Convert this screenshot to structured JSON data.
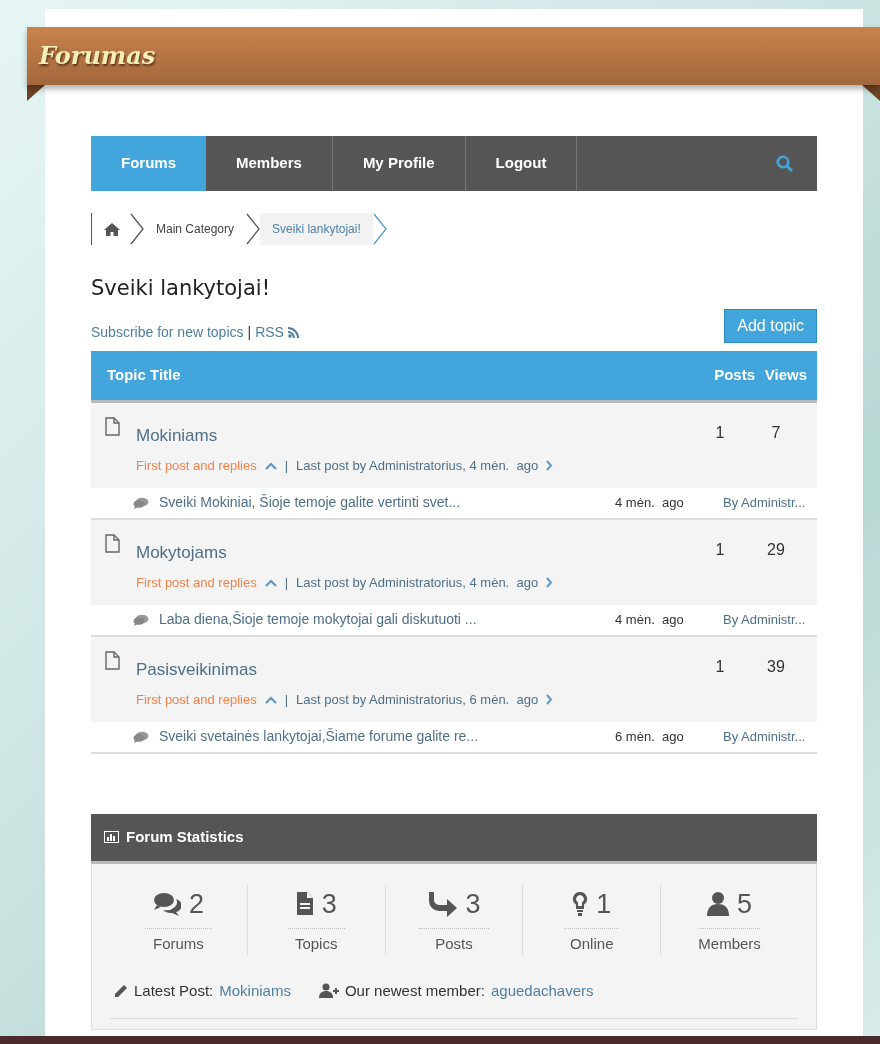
{
  "site_title": "Forumas",
  "nav": [
    {
      "label": "Forums",
      "selected": true
    },
    {
      "label": "Members",
      "selected": false
    },
    {
      "label": "My Profile",
      "selected": false
    },
    {
      "label": "Logout",
      "selected": false
    }
  ],
  "breadcrumb": [
    {
      "label": "Main Category",
      "selected": false
    },
    {
      "label": "Sveiki lankytojai!",
      "selected": true
    }
  ],
  "forum_title": "Sveiki lankytojai!",
  "subscribe": {
    "link": "Subscribe for new topics",
    "separator": "|",
    "rss": "RSS"
  },
  "add_topic": "Add topic",
  "table": {
    "columns": [
      "Topic Title",
      "Posts",
      "Views"
    ],
    "rows": [
      {
        "title": "Mokiniams",
        "posts": "1",
        "views": "7",
        "first_post": "First post and replies",
        "separator": "|",
        "last_post": "Last post by Administratorius, 4 mėn.  ago",
        "reply": {
          "excerpt": "Sveiki Mokiniai, Šioje temoje galite vertinti svet...",
          "time": "4 mėn.  ago",
          "author": "By Administr..."
        }
      },
      {
        "title": "Mokytojams",
        "posts": "1",
        "views": "29",
        "first_post": "First post and replies",
        "separator": "|",
        "last_post": "Last post by Administratorius, 4 mėn.  ago",
        "reply": {
          "excerpt": "Laba diena,Šioje temoje mokytojai gali diskutuoti ...",
          "time": "4 mėn.  ago",
          "author": "By Administr..."
        }
      },
      {
        "title": "Pasisveikinimas",
        "posts": "1",
        "views": "39",
        "first_post": "First post and replies",
        "separator": "|",
        "last_post": "Last post by Administratorius, 6 mėn.  ago",
        "reply": {
          "excerpt": "Sveiki svetainės lankytojai,Šiame forume galite re...",
          "time": "6 mėn.  ago",
          "author": "By Administr..."
        }
      }
    ]
  },
  "statistics": {
    "title": "Forum Statistics",
    "items": [
      {
        "kind": "forums",
        "value": "2",
        "label": "Forums"
      },
      {
        "kind": "topics",
        "value": "3",
        "label": "Topics"
      },
      {
        "kind": "posts",
        "value": "3",
        "label": "Posts"
      },
      {
        "kind": "online",
        "value": "1",
        "label": "Online"
      },
      {
        "kind": "members",
        "value": "5",
        "label": "Members"
      }
    ],
    "latest_post": {
      "label": "Latest Post:",
      "link": "Mokiniams"
    },
    "newest_member": {
      "label": "Our newest member:",
      "link": "aguedachavers"
    }
  }
}
